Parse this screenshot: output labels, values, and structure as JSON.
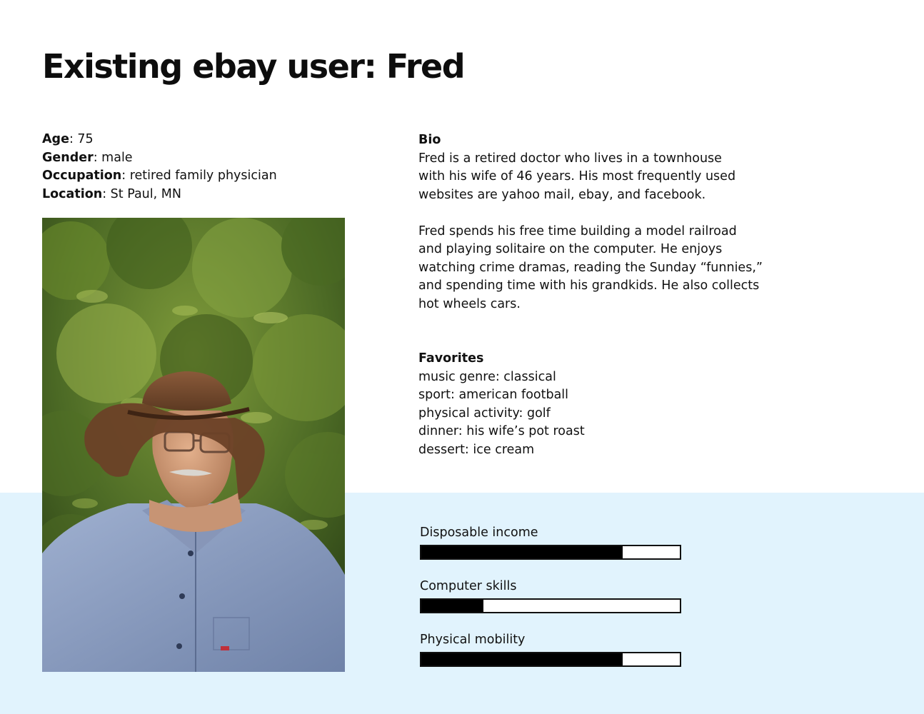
{
  "title": "Existing ebay user: Fred",
  "facts": [
    {
      "label": "Age",
      "value": ": 75"
    },
    {
      "label": "Gender",
      "value": ": male"
    },
    {
      "label": "Occupation",
      "value": ": retired family physician"
    },
    {
      "label": "Location",
      "value": ": St Paul, MN"
    }
  ],
  "bio": {
    "heading": "Bio",
    "paragraph1": [
      "Fred is a retired doctor who lives in a townhouse",
      "with his wife of 46 years. His most frequently used",
      "websites are yahoo mail, ebay, and facebook."
    ],
    "paragraph2": [
      "Fred spends his free time building a model railroad",
      "and playing solitaire on the computer. He enjoys",
      "watching crime dramas, reading the Sunday “funnies,”",
      "and spending time with his grandkids. He also collects",
      "hot wheels cars."
    ]
  },
  "favorites": {
    "heading": "Favorites",
    "items": [
      "music genre: classical",
      "sport: american football",
      "physical activity: golf",
      "dinner: his wife’s pot roast",
      "dessert: ice cream"
    ]
  },
  "meters": [
    {
      "label": "Disposable income",
      "level": 0.78
    },
    {
      "label": "Computer skills",
      "level": 0.24
    },
    {
      "label": "Physical mobility",
      "level": 0.78
    }
  ],
  "colors": {
    "band": "#e1f3fd",
    "meter_fill": "#000000",
    "meter_track": "#ffffff"
  },
  "photo": {
    "subject": "portrait-photo"
  }
}
